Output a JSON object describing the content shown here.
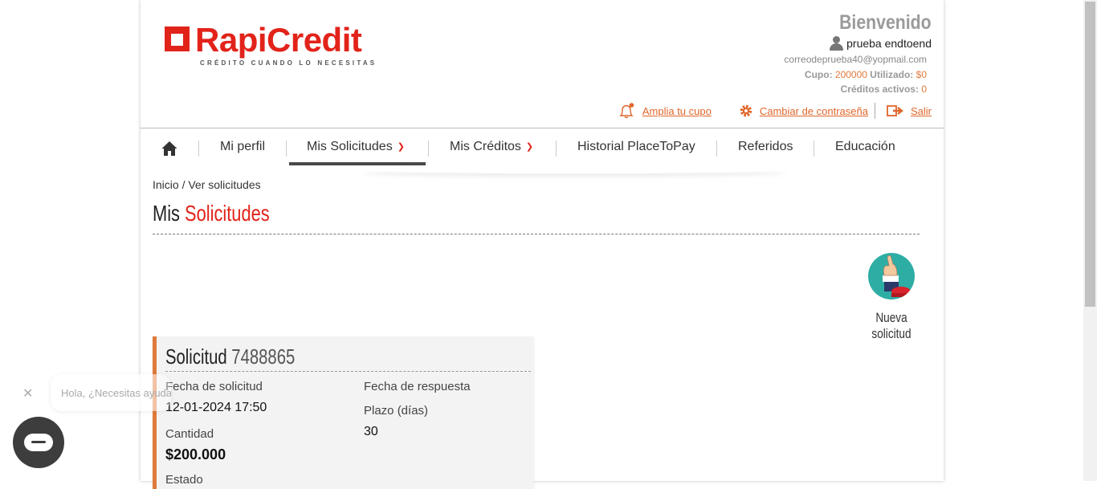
{
  "header": {
    "logo_text": "RapiCredit",
    "logo_tagline": "CRÉDITO CUANDO LO NECESITAS",
    "welcome": "Bienvenido",
    "user_name": "prueba endtoend",
    "email": "correodeprueba40@yopmail.com",
    "cupo_label": "Cupo:",
    "cupo_value": "200000",
    "utilizado_label": "Utilizado:",
    "utilizado_value": "$0",
    "creditos_label": "Créditos activos:",
    "creditos_value": "0",
    "links": {
      "amplia": "Amplia tu cupo",
      "cambiar": "Cambiar de contraseña",
      "salir": "Salir"
    },
    "accent_color": "#e2231a",
    "link_color": "#e0662a"
  },
  "nav": {
    "items": [
      {
        "label": "Mi perfil"
      },
      {
        "label": "Mis Solicitudes"
      },
      {
        "label": "Mis Créditos"
      },
      {
        "label": "Historial PlaceToPay"
      },
      {
        "label": "Referidos"
      },
      {
        "label": "Educación"
      }
    ],
    "active": "Mis Solicitudes"
  },
  "breadcrumb": "Inicio / Ver solicitudes",
  "title": {
    "part1": "Mis",
    "part2": "Solicitudes"
  },
  "nueva_solicitud": "Nueva solicitud",
  "solicitud": {
    "title": "Solicitud",
    "number": "7488865",
    "fecha_solicitud_label": "Fecha de solicitud",
    "fecha_solicitud_value": "12-01-2024 17:50",
    "fecha_respuesta_label": "Fecha de respuesta",
    "plazo_label": "Plazo (días)",
    "plazo_value": "30",
    "cantidad_label": "Cantidad",
    "cantidad_value": "$200.000",
    "estado_label": "Estado"
  },
  "chat": {
    "bubble_text": "Hola, ¿Necesitas ayuda?"
  }
}
